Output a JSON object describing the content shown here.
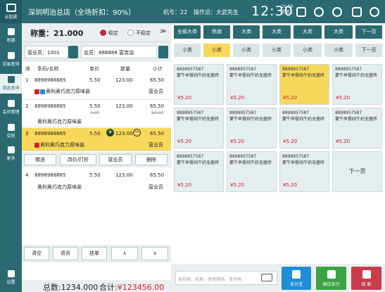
{
  "topbar": {
    "brand": "云智雾",
    "store": "深圳明治总店（全场折扣：90%）",
    "machine": "机号：22",
    "operator": "操作员：大武先生",
    "time": "12:30",
    "date_line1": "10-10",
    "date_line2": "星期二"
  },
  "nav": {
    "items": [
      {
        "label": "收银"
      },
      {
        "label": "交易查询"
      },
      {
        "label": "商品查询"
      },
      {
        "label": "会员管理"
      },
      {
        "label": "交班"
      },
      {
        "label": "更多"
      },
      {
        "label": "设置"
      }
    ]
  },
  "scale": {
    "weight_label": "称重：21.000",
    "stable": "稳定",
    "unstable": "不稳定"
  },
  "member": {
    "clerk": "营业员：1001",
    "member": "会员：888888 富克油"
  },
  "table": {
    "headers": [
      "序",
      "条码/名称",
      "单价",
      "数量",
      "小计"
    ],
    "rows": [
      {
        "idx": "1",
        "code": "8898988885",
        "name": "奥利奥巧克力原味装",
        "price": "5.50",
        "qty": "123.00",
        "sub": "65.50",
        "note": "营业员",
        "old_price": "",
        "old_sub": ""
      },
      {
        "idx": "2",
        "code": "8898988885",
        "name": "奥利奥巧克力原味装",
        "price": "5.50",
        "qty": "123.00",
        "sub": "65.50",
        "note": "",
        "old_price": "4.00",
        "old_sub": "50.00"
      },
      {
        "idx": "3",
        "code": "8898988885",
        "name": "奥利奥巧克力原味装",
        "price": "5.50",
        "qty": "123.00",
        "sub": "65.50",
        "note": "营业员",
        "old_price": "",
        "old_sub": ""
      },
      {
        "idx": "4",
        "code": "8898988885",
        "name": "奥利奥巧克力原味装",
        "price": "5.50",
        "qty": "123.00",
        "sub": "65.50",
        "note": "营业员",
        "old_price": "",
        "old_sub": ""
      }
    ]
  },
  "row_actions": {
    "gift": "赠送",
    "change": "改价/打折",
    "clerk": "营业员",
    "delete": "删除"
  },
  "bottom": {
    "clear": "清空",
    "return": "退货",
    "hang": "挂单",
    "up": "∧",
    "down": "∨"
  },
  "totals": {
    "qty": "总数:1234.000",
    "amount_label": "合计:",
    "amount": "¥123456.00"
  },
  "categories": {
    "big": [
      "全部大类",
      "热销",
      "大类",
      "大类",
      "大类",
      "大类",
      "下一页"
    ],
    "small": [
      "小类",
      "小类",
      "小类",
      "小类",
      "小类",
      "小类",
      "下一页"
    ]
  },
  "products": [
    {
      "code": "8898957587",
      "name": "蒙牛早餐纯牛奶无菌砖",
      "price": "¥5.20",
      "hl": false
    },
    {
      "code": "8898957587",
      "name": "蒙牛早餐纯牛奶无菌砖",
      "price": "¥5.20",
      "hl": false
    },
    {
      "code": "8898957587",
      "name": "蒙牛早餐纯牛奶无菌砖",
      "price": "¥5.20",
      "hl": true
    },
    {
      "code": "8898957587",
      "name": "蒙牛早餐纯牛奶无菌砖",
      "price": "¥5.20",
      "hl": false
    },
    {
      "code": "8898957587",
      "name": "蒙牛早餐纯牛奶无菌砖",
      "price": "¥5.20",
      "hl": false
    },
    {
      "code": "8898957587",
      "name": "蒙牛早餐纯牛奶无菌砖",
      "price": "¥5.20",
      "hl": false
    },
    {
      "code": "8898957587",
      "name": "蒙牛早餐纯牛奶无菌砖",
      "price": "¥5.20",
      "hl": false
    },
    {
      "code": "8898957587",
      "name": "蒙牛早餐纯牛奶无菌砖",
      "price": "¥5.20",
      "hl": false
    },
    {
      "code": "8898957587",
      "name": "蒙牛早餐纯牛奶无菌砖",
      "price": "¥5.20",
      "hl": false
    },
    {
      "code": "8898957587",
      "name": "蒙牛早餐纯牛奶无菌砖",
      "price": "¥5.20",
      "hl": false
    },
    {
      "code": "8898957587",
      "name": "蒙牛早餐纯牛奶无菌砖",
      "price": "¥5.20",
      "hl": false
    }
  ],
  "next_page": "下一页",
  "search": {
    "placeholder": "条形码、名称、拼音简码、支付码"
  },
  "pay": {
    "alipay": "支付宝",
    "wechat": "微信支付",
    "checkout": "结 账"
  },
  "colors": {
    "accent": "#2b6a72",
    "highlight": "#f8d85a",
    "price": "#d0202a",
    "alipay": "#1f8ed8",
    "wechat": "#3aa344",
    "checkout": "#c93d4a"
  }
}
